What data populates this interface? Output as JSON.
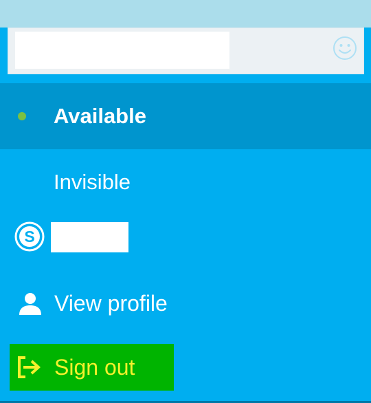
{
  "mood": {
    "placeholder": "",
    "value": "",
    "emoticon_icon": "smiley-icon"
  },
  "status": {
    "available_label": "Available",
    "invisible_label": "Invisible",
    "selected": "Available",
    "available_dot_color": "#7AC143"
  },
  "account": {
    "icon": "skype-icon",
    "name": ""
  },
  "menu": {
    "view_profile_label": "View profile",
    "view_profile_icon": "person-icon",
    "sign_out_label": "Sign out",
    "sign_out_icon": "sign-out-icon"
  },
  "colors": {
    "background": "#00AEF0",
    "selected_row": "#0095CE",
    "sign_out_highlight": "#00B400",
    "sign_out_text": "#F4F12C"
  }
}
